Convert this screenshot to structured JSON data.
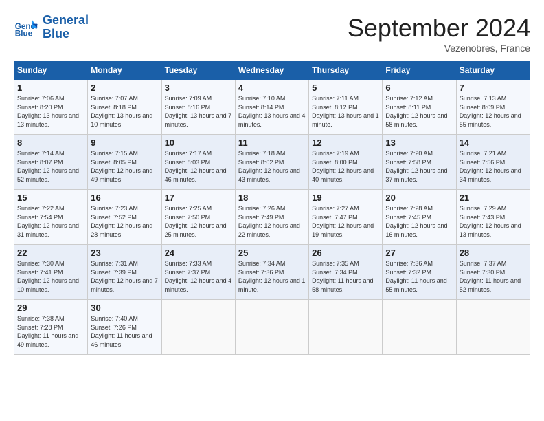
{
  "header": {
    "logo_line1": "General",
    "logo_line2": "Blue",
    "month": "September 2024",
    "location": "Vezenobres, France"
  },
  "weekdays": [
    "Sunday",
    "Monday",
    "Tuesday",
    "Wednesday",
    "Thursday",
    "Friday",
    "Saturday"
  ],
  "weeks": [
    [
      {
        "day": "1",
        "sunrise": "Sunrise: 7:06 AM",
        "sunset": "Sunset: 8:20 PM",
        "daylight": "Daylight: 13 hours and 13 minutes."
      },
      {
        "day": "2",
        "sunrise": "Sunrise: 7:07 AM",
        "sunset": "Sunset: 8:18 PM",
        "daylight": "Daylight: 13 hours and 10 minutes."
      },
      {
        "day": "3",
        "sunrise": "Sunrise: 7:09 AM",
        "sunset": "Sunset: 8:16 PM",
        "daylight": "Daylight: 13 hours and 7 minutes."
      },
      {
        "day": "4",
        "sunrise": "Sunrise: 7:10 AM",
        "sunset": "Sunset: 8:14 PM",
        "daylight": "Daylight: 13 hours and 4 minutes."
      },
      {
        "day": "5",
        "sunrise": "Sunrise: 7:11 AM",
        "sunset": "Sunset: 8:12 PM",
        "daylight": "Daylight: 13 hours and 1 minute."
      },
      {
        "day": "6",
        "sunrise": "Sunrise: 7:12 AM",
        "sunset": "Sunset: 8:11 PM",
        "daylight": "Daylight: 12 hours and 58 minutes."
      },
      {
        "day": "7",
        "sunrise": "Sunrise: 7:13 AM",
        "sunset": "Sunset: 8:09 PM",
        "daylight": "Daylight: 12 hours and 55 minutes."
      }
    ],
    [
      {
        "day": "8",
        "sunrise": "Sunrise: 7:14 AM",
        "sunset": "Sunset: 8:07 PM",
        "daylight": "Daylight: 12 hours and 52 minutes."
      },
      {
        "day": "9",
        "sunrise": "Sunrise: 7:15 AM",
        "sunset": "Sunset: 8:05 PM",
        "daylight": "Daylight: 12 hours and 49 minutes."
      },
      {
        "day": "10",
        "sunrise": "Sunrise: 7:17 AM",
        "sunset": "Sunset: 8:03 PM",
        "daylight": "Daylight: 12 hours and 46 minutes."
      },
      {
        "day": "11",
        "sunrise": "Sunrise: 7:18 AM",
        "sunset": "Sunset: 8:02 PM",
        "daylight": "Daylight: 12 hours and 43 minutes."
      },
      {
        "day": "12",
        "sunrise": "Sunrise: 7:19 AM",
        "sunset": "Sunset: 8:00 PM",
        "daylight": "Daylight: 12 hours and 40 minutes."
      },
      {
        "day": "13",
        "sunrise": "Sunrise: 7:20 AM",
        "sunset": "Sunset: 7:58 PM",
        "daylight": "Daylight: 12 hours and 37 minutes."
      },
      {
        "day": "14",
        "sunrise": "Sunrise: 7:21 AM",
        "sunset": "Sunset: 7:56 PM",
        "daylight": "Daylight: 12 hours and 34 minutes."
      }
    ],
    [
      {
        "day": "15",
        "sunrise": "Sunrise: 7:22 AM",
        "sunset": "Sunset: 7:54 PM",
        "daylight": "Daylight: 12 hours and 31 minutes."
      },
      {
        "day": "16",
        "sunrise": "Sunrise: 7:23 AM",
        "sunset": "Sunset: 7:52 PM",
        "daylight": "Daylight: 12 hours and 28 minutes."
      },
      {
        "day": "17",
        "sunrise": "Sunrise: 7:25 AM",
        "sunset": "Sunset: 7:50 PM",
        "daylight": "Daylight: 12 hours and 25 minutes."
      },
      {
        "day": "18",
        "sunrise": "Sunrise: 7:26 AM",
        "sunset": "Sunset: 7:49 PM",
        "daylight": "Daylight: 12 hours and 22 minutes."
      },
      {
        "day": "19",
        "sunrise": "Sunrise: 7:27 AM",
        "sunset": "Sunset: 7:47 PM",
        "daylight": "Daylight: 12 hours and 19 minutes."
      },
      {
        "day": "20",
        "sunrise": "Sunrise: 7:28 AM",
        "sunset": "Sunset: 7:45 PM",
        "daylight": "Daylight: 12 hours and 16 minutes."
      },
      {
        "day": "21",
        "sunrise": "Sunrise: 7:29 AM",
        "sunset": "Sunset: 7:43 PM",
        "daylight": "Daylight: 12 hours and 13 minutes."
      }
    ],
    [
      {
        "day": "22",
        "sunrise": "Sunrise: 7:30 AM",
        "sunset": "Sunset: 7:41 PM",
        "daylight": "Daylight: 12 hours and 10 minutes."
      },
      {
        "day": "23",
        "sunrise": "Sunrise: 7:31 AM",
        "sunset": "Sunset: 7:39 PM",
        "daylight": "Daylight: 12 hours and 7 minutes."
      },
      {
        "day": "24",
        "sunrise": "Sunrise: 7:33 AM",
        "sunset": "Sunset: 7:37 PM",
        "daylight": "Daylight: 12 hours and 4 minutes."
      },
      {
        "day": "25",
        "sunrise": "Sunrise: 7:34 AM",
        "sunset": "Sunset: 7:36 PM",
        "daylight": "Daylight: 12 hours and 1 minute."
      },
      {
        "day": "26",
        "sunrise": "Sunrise: 7:35 AM",
        "sunset": "Sunset: 7:34 PM",
        "daylight": "Daylight: 11 hours and 58 minutes."
      },
      {
        "day": "27",
        "sunrise": "Sunrise: 7:36 AM",
        "sunset": "Sunset: 7:32 PM",
        "daylight": "Daylight: 11 hours and 55 minutes."
      },
      {
        "day": "28",
        "sunrise": "Sunrise: 7:37 AM",
        "sunset": "Sunset: 7:30 PM",
        "daylight": "Daylight: 11 hours and 52 minutes."
      }
    ],
    [
      {
        "day": "29",
        "sunrise": "Sunrise: 7:38 AM",
        "sunset": "Sunset: 7:28 PM",
        "daylight": "Daylight: 11 hours and 49 minutes."
      },
      {
        "day": "30",
        "sunrise": "Sunrise: 7:40 AM",
        "sunset": "Sunset: 7:26 PM",
        "daylight": "Daylight: 11 hours and 46 minutes."
      },
      null,
      null,
      null,
      null,
      null
    ]
  ]
}
